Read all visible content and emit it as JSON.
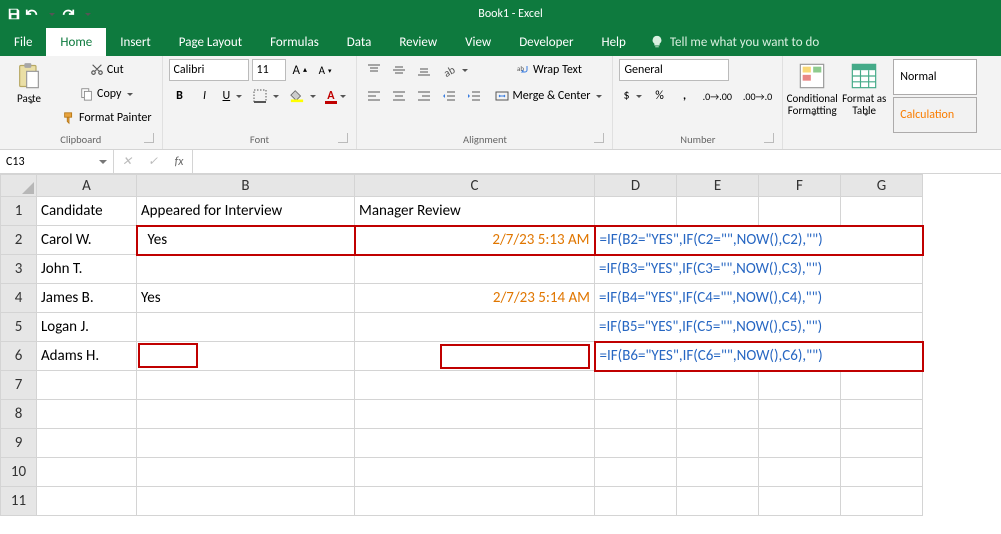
{
  "titlebar": {
    "title": "Book1 - Excel"
  },
  "menu": {
    "tabs": [
      "File",
      "Home",
      "Insert",
      "Page Layout",
      "Formulas",
      "Data",
      "Review",
      "View",
      "Developer",
      "Help"
    ],
    "active": 1,
    "tellme": "Tell me what you want to do"
  },
  "ribbon": {
    "clipboard": {
      "label": "Clipboard",
      "paste": "Paste",
      "cut": "Cut",
      "copy": "Copy",
      "fmtpainter": "Format Painter"
    },
    "font": {
      "label": "Font",
      "name": "Calibri",
      "size": "11"
    },
    "alignment": {
      "label": "Alignment",
      "wrap": "Wrap Text",
      "merge": "Merge & Center"
    },
    "number": {
      "label": "Number",
      "format": "General"
    },
    "styles": {
      "cond": "Conditional\nFormatting",
      "fmtTable": "Format as\nTable",
      "normal": "Normal",
      "calc": "Calculation"
    }
  },
  "namebox": "C13",
  "columns": [
    "A",
    "B",
    "C",
    "D",
    "E",
    "F",
    "G"
  ],
  "rows": [
    "1",
    "2",
    "3",
    "4",
    "5",
    "6",
    "7",
    "8",
    "9",
    "10",
    "11"
  ],
  "headers": {
    "A": "Candidate",
    "B": "Appeared for Interview",
    "C": "Manager Review"
  },
  "data": [
    {
      "name": "Carol W.",
      "appeared": "Yes",
      "review": "2/7/23 5:13 AM",
      "formula": "=IF(B2=\"YES\",IF(C2=\"\",NOW(),C2),\"\")"
    },
    {
      "name": "John T.",
      "appeared": "",
      "review": "",
      "formula": "=IF(B3=\"YES\",IF(C3=\"\",NOW(),C3),\"\")"
    },
    {
      "name": "James B.",
      "appeared": "Yes",
      "review": "2/7/23 5:14 AM",
      "formula": "=IF(B4=\"YES\",IF(C4=\"\",NOW(),C4),\"\")"
    },
    {
      "name": "Logan J.",
      "appeared": "",
      "review": "",
      "formula": "=IF(B5=\"YES\",IF(C5=\"\",NOW(),C5),\"\")"
    },
    {
      "name": "Adams H.",
      "appeared": "",
      "review": "",
      "formula": "=IF(B6=\"YES\",IF(C6=\"\",NOW(),C6),\"\")"
    }
  ]
}
